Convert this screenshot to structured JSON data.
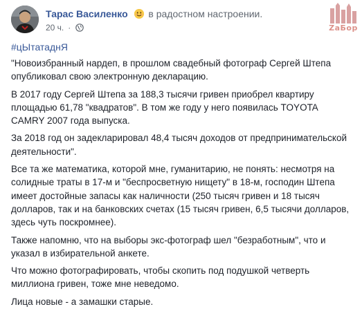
{
  "post": {
    "author": "Тарас Василенко",
    "feeling": "в радостном настроении.",
    "time": "20 ч.",
    "separator": "·",
    "watermark_text": "ZaБор",
    "hashtag": "#цЫтатаднЯ",
    "paragraphs": [
      "\"Новоизбранный нардеп, в прошлом свадебный фотограф Сергей Штепа опубликовал свою электронную декларацию.",
      "В 2017 году Сергей Штепа за 188,3 тысячи гривен приобрел квартиру площадью 61,78 \"квадратов\". В том же году у него появилась TOYOTA CAMRY 2007 года выпуска.",
      "За 2018 год он задекларировал 48,4 тысяч доходов от предпринимательской деятельности\".",
      "Все та же математика, которой мне, гуманитарию, не понять: несмотря на солидные траты в 17-м и \"беспросветную нищету\" в 18-м, господин Штепа имеет достойные запасы как наличности (250 тысяч гривен и 18 тысяч долларов, так и на банковских счетах (15 тысяч гривен, 6,5 тысячи долларов, здесь чуть поскромнее).",
      "Также напомню, что на выборы экс-фотограф шел \"безработным\", что и указал в избирательной анкете.",
      "Что можно фотографировать, чтобы скопить под подушкой четверть миллиона гривен, тоже мне неведомо.",
      "Лица новые - а замашки старые."
    ]
  },
  "icons": {
    "avatar": "avatar",
    "emoji": "smiling-face-icon",
    "privacy": "globe-icon",
    "watermark": "watermark-logo"
  },
  "colors": {
    "link": "#385898",
    "text": "#1d2129",
    "meta": "#606770",
    "emoji": "#f7c948"
  }
}
